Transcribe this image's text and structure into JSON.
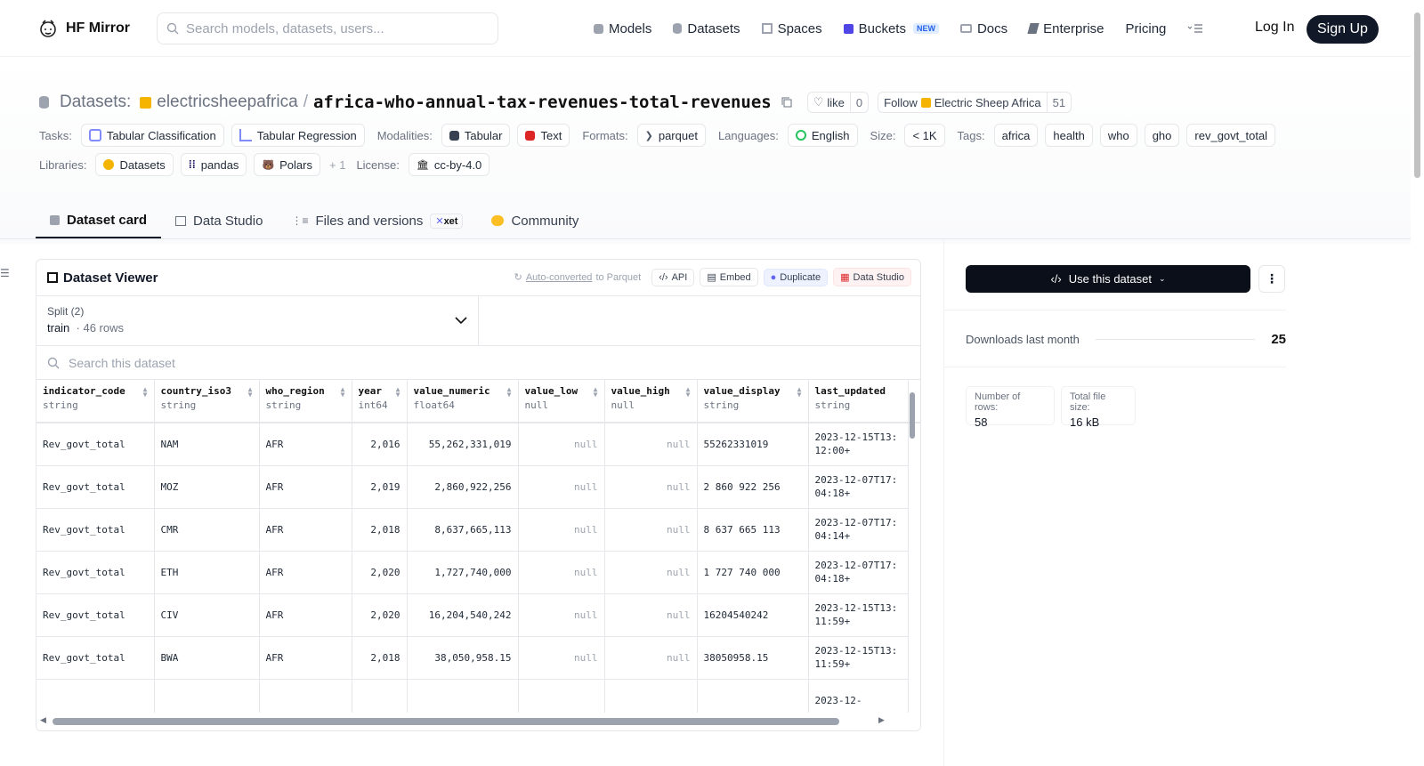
{
  "nav": {
    "brand": "HF Mirror",
    "search_placeholder": "Search models, datasets, users...",
    "links": [
      "Models",
      "Datasets",
      "Spaces",
      "Buckets",
      "Docs",
      "Enterprise",
      "Pricing"
    ],
    "buckets_badge": "NEW",
    "login": "Log In",
    "signup": "Sign Up"
  },
  "header": {
    "label": "Datasets:",
    "author": "electricsheepafrica",
    "separator": "/",
    "repo": "africa-who-annual-tax-revenues-total-revenues",
    "like_label": "like",
    "like_count": "0",
    "follow_label": "Follow",
    "follow_org": "Electric Sheep Africa",
    "follow_count": "51"
  },
  "meta": {
    "tasks_label": "Tasks:",
    "tasks": [
      "Tabular Classification",
      "Tabular Regression"
    ],
    "modalities_label": "Modalities:",
    "modalities": [
      "Tabular",
      "Text"
    ],
    "formats_label": "Formats:",
    "formats": [
      "parquet"
    ],
    "languages_label": "Languages:",
    "languages": [
      "English"
    ],
    "size_label": "Size:",
    "size": "< 1K",
    "tags_label": "Tags:",
    "tags": [
      "africa",
      "health",
      "who",
      "gho",
      "rev_govt_total"
    ],
    "libraries_label": "Libraries:",
    "libraries": [
      "Datasets",
      "pandas",
      "Polars"
    ],
    "libraries_more": "+ 1",
    "license_label": "License:",
    "license": "cc-by-4.0"
  },
  "tabs": [
    "Dataset card",
    "Data Studio",
    "Files and versions",
    "Community"
  ],
  "xet_badge": "xet",
  "viewer": {
    "title": "Dataset Viewer",
    "auto_converted": "Auto-converted",
    "to_parquet": " to Parquet",
    "api": "API",
    "embed": "Embed",
    "duplicate": "Duplicate",
    "data_studio": "Data Studio",
    "split_label": "Split (2)",
    "split_name": "train",
    "split_rows": "46 rows",
    "search_placeholder": "Search this dataset",
    "columns": [
      {
        "name": "indicator_code",
        "type": "string"
      },
      {
        "name": "country_iso3",
        "type": "string"
      },
      {
        "name": "who_region",
        "type": "string"
      },
      {
        "name": "year",
        "type": "int64"
      },
      {
        "name": "value_numeric",
        "type": "float64"
      },
      {
        "name": "value_low",
        "type": "null"
      },
      {
        "name": "value_high",
        "type": "null"
      },
      {
        "name": "value_display",
        "type": "string"
      },
      {
        "name": "last_updated",
        "type": "string"
      }
    ],
    "rows": [
      [
        "Rev_govt_total",
        "NAM",
        "AFR",
        "2,016",
        "55,262,331,019",
        "null",
        "null",
        "55262331019",
        "2023-12-15T13:12:00+"
      ],
      [
        "Rev_govt_total",
        "MOZ",
        "AFR",
        "2,019",
        "2,860,922,256",
        "null",
        "null",
        "2 860 922 256",
        "2023-12-07T17:04:18+"
      ],
      [
        "Rev_govt_total",
        "CMR",
        "AFR",
        "2,018",
        "8,637,665,113",
        "null",
        "null",
        "8 637 665 113",
        "2023-12-07T17:04:14+"
      ],
      [
        "Rev_govt_total",
        "ETH",
        "AFR",
        "2,020",
        "1,727,740,000",
        "null",
        "null",
        "1 727 740 000",
        "2023-12-07T17:04:18+"
      ],
      [
        "Rev_govt_total",
        "CIV",
        "AFR",
        "2,020",
        "16,204,540,242",
        "null",
        "null",
        "16204540242",
        "2023-12-15T13:11:59+"
      ],
      [
        "Rev_govt_total",
        "BWA",
        "AFR",
        "2,018",
        "38,050,958.15",
        "null",
        "null",
        "38050958.15",
        "2023-12-15T13:11:59+"
      ],
      [
        "",
        "",
        "",
        "",
        "",
        "",
        "",
        "",
        "2023-12-"
      ]
    ]
  },
  "sidebar": {
    "use_dataset": "Use this dataset",
    "downloads_label": "Downloads last month",
    "downloads_value": "25",
    "rows_label": "Number of rows:",
    "rows_value": "58",
    "size_label": "Total file size:",
    "size_value": "16 kB"
  }
}
